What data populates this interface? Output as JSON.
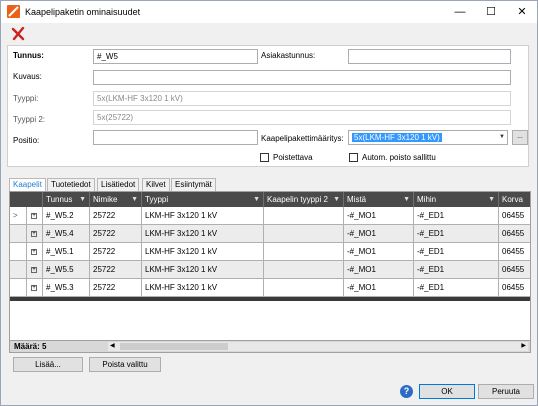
{
  "window": {
    "title": "Kaapelipaketin ominaisuudet",
    "minimize": "—",
    "maximize": "☐",
    "close": "✕"
  },
  "form": {
    "tunnus_label": "Tunnus:",
    "tunnus_value": "#_W5",
    "asiakastunnus_label": "Asiakastunnus:",
    "asiakastunnus_value": "",
    "kuvaus_label": "Kuvaus:",
    "kuvaus_value": "",
    "tyyppi_label": "Tyyppi:",
    "tyyppi_value": "5x(LKM-HF 3x120  1 kV)",
    "tyyppi2_label": "Tyyppi 2:",
    "tyyppi2_value": "5x(25722)",
    "positio_label": "Positio:",
    "positio_value": "",
    "maaritys_label": "Kaapelipakettimääritys:",
    "maaritys_value": "5x(LKM-HF 3x120  1 kV)",
    "maaritys_button": "...",
    "poistettava_label": "Poistettava",
    "autom_label": "Autom. poisto sallittu"
  },
  "tabs": [
    "Kaapelit",
    "Tuotetiedot",
    "Lisätiedot",
    "Kilvet",
    "Esiintymät"
  ],
  "grid": {
    "columns": [
      "Tunnus",
      "Nimike",
      "Tyyppi",
      "Kaapelin tyyppi 2",
      "Mistä",
      "Mihin",
      "Korva"
    ],
    "rows": [
      [
        "#_W5.2",
        "25722",
        "LKM-HF 3x120  1 kV",
        "",
        "-#_MO1",
        "-#_ED1",
        "06455"
      ],
      [
        "#_W5.4",
        "25722",
        "LKM-HF 3x120  1 kV",
        "",
        "-#_MO1",
        "-#_ED1",
        "06455"
      ],
      [
        "#_W5.1",
        "25722",
        "LKM-HF 3x120  1 kV",
        "",
        "-#_MO1",
        "-#_ED1",
        "06455"
      ],
      [
        "#_W5.5",
        "25722",
        "LKM-HF 3x120  1 kV",
        "",
        "-#_MO1",
        "-#_ED1",
        "06455"
      ],
      [
        "#_W5.3",
        "25722",
        "LKM-HF 3x120  1 kV",
        "",
        "-#_MO1",
        "-#_ED1",
        "06455"
      ]
    ],
    "row_marker": ">",
    "expander": "+",
    "count_label": "Määrä: 5"
  },
  "buttons": {
    "add": "Lisää...",
    "remove": "Poista valittu",
    "help": "?",
    "ok": "OK",
    "cancel": "Peruuta"
  },
  "colors": {
    "accent": "#1e7fd8",
    "header_bg": "#4a4a4a",
    "selection": "#3399ff",
    "app_icon": "#e8621a",
    "delete_icon": "#cc2222"
  },
  "icons": {
    "app": "app-icon",
    "delete": "delete-x-icon",
    "filter": "filter-icon",
    "help": "help-icon"
  }
}
